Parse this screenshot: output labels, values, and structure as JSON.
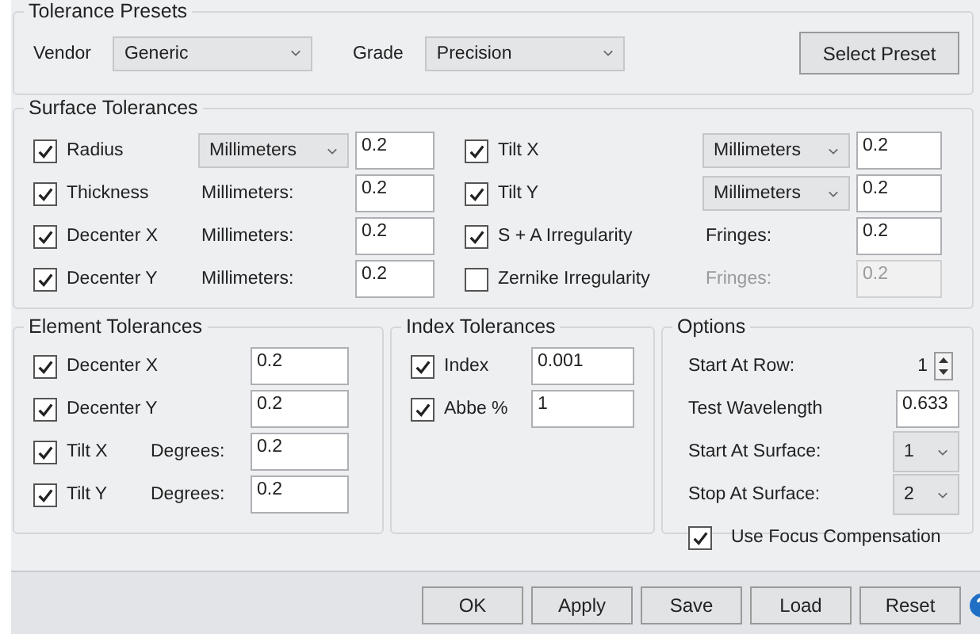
{
  "presets": {
    "title": "Tolerance Presets",
    "vendor_label": "Vendor",
    "vendor": "Generic",
    "grade_label": "Grade",
    "grade": "Precision",
    "button": "Select Preset"
  },
  "surface_tolerances": {
    "title": "Surface Tolerances",
    "rows": [
      {
        "label": "Radius",
        "checked": true,
        "unit": {
          "kind": "dropdown",
          "text": "Millimeters"
        },
        "value": "0.2",
        "disabled": false
      },
      {
        "label": "Tilt X",
        "checked": true,
        "unit": {
          "kind": "dropdown",
          "text": "Millimeters"
        },
        "value": "0.2",
        "disabled": false
      },
      {
        "label": "Thickness",
        "checked": true,
        "unit": {
          "kind": "label",
          "text": "Millimeters:"
        },
        "value": "0.2",
        "disabled": false
      },
      {
        "label": "Tilt Y",
        "checked": true,
        "unit": {
          "kind": "dropdown",
          "text": "Millimeters"
        },
        "value": "0.2",
        "disabled": false
      },
      {
        "label": "Decenter X",
        "checked": true,
        "unit": {
          "kind": "label",
          "text": "Millimeters:"
        },
        "value": "0.2",
        "disabled": false
      },
      {
        "label": "S + A Irregularity",
        "checked": true,
        "unit": {
          "kind": "label",
          "text": "Fringes:"
        },
        "value": "0.2",
        "disabled": false
      },
      {
        "label": "Decenter Y",
        "checked": true,
        "unit": {
          "kind": "label",
          "text": "Millimeters:"
        },
        "value": "0.2",
        "disabled": false
      },
      {
        "label": "Zernike Irregularity",
        "checked": false,
        "unit": {
          "kind": "label",
          "text": "Fringes:"
        },
        "value": "0.2",
        "disabled": true
      }
    ]
  },
  "element_tolerances": {
    "title": "Element Tolerances",
    "rows": [
      {
        "label": "Decenter X",
        "checked": true,
        "value": "0.2"
      },
      {
        "label": "Decenter Y",
        "checked": true,
        "value": "0.2"
      },
      {
        "label": "Tilt X",
        "checked": true,
        "unit": "Degrees:",
        "value": "0.2"
      },
      {
        "label": "Tilt Y",
        "checked": true,
        "unit": "Degrees:",
        "value": "0.2"
      }
    ]
  },
  "index_tolerances": {
    "title": "Index Tolerances",
    "rows": [
      {
        "label": "Index",
        "checked": true,
        "value": "0.001"
      },
      {
        "label": "Abbe %",
        "checked": true,
        "value": "1"
      }
    ]
  },
  "options": {
    "title": "Options",
    "items": [
      {
        "kind": "spinner",
        "label": "Start At Row:",
        "value": "1"
      },
      {
        "kind": "input",
        "label": "Test Wavelength",
        "value": "0.633"
      },
      {
        "kind": "dropdown",
        "label": "Start At Surface:",
        "value": "1"
      },
      {
        "kind": "dropdown",
        "label": "Stop At Surface:",
        "value": "2"
      },
      {
        "kind": "checkbox",
        "label": "Use Focus Compensation",
        "checked": true
      }
    ]
  },
  "buttons": [
    "OK",
    "Apply",
    "Save",
    "Load",
    "Reset"
  ]
}
